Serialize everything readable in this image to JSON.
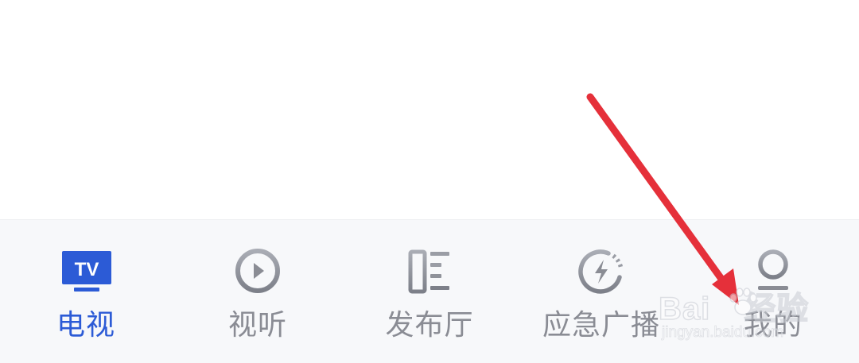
{
  "tabbar": {
    "tabs": [
      {
        "label": "电视",
        "icon_text": "TV",
        "icon": "tv-icon",
        "active": true
      },
      {
        "label": "视听",
        "icon": "play-circle-icon",
        "active": false
      },
      {
        "label": "发布厅",
        "icon": "list-layout-icon",
        "active": false
      },
      {
        "label": "应急广播",
        "icon": "emergency-broadcast-icon",
        "active": false
      },
      {
        "label": "我的",
        "icon": "user-profile-icon",
        "active": false
      }
    ]
  },
  "watermark": {
    "line1": "Bai",
    "line1_end": "经验",
    "line2": "jingyan.baidu.com"
  },
  "colors": {
    "active": "#2c5bd6",
    "inactive": "#8a8c94",
    "tabbar_bg": "#f7f8fa",
    "annotation_arrow": "#e5303a"
  }
}
